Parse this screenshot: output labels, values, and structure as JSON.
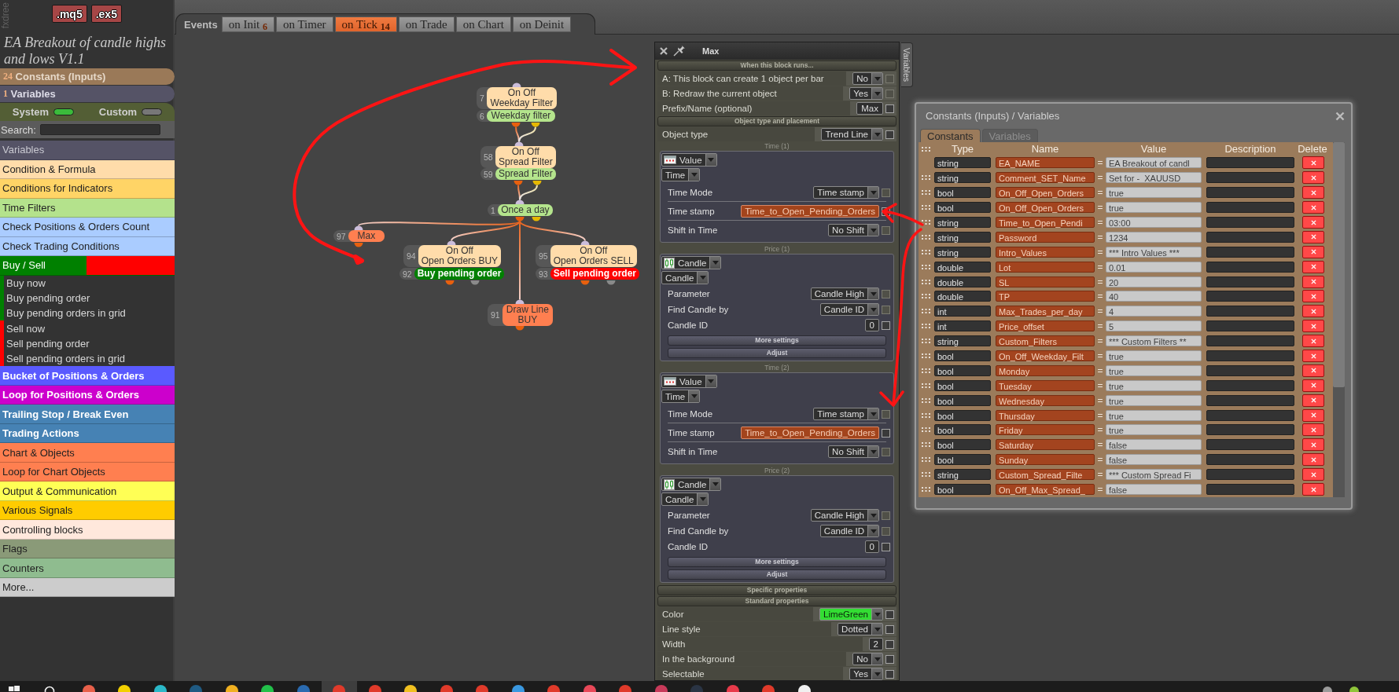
{
  "app": {
    "logo_text": "fxdree",
    "export_buttons": [
      ".mq5",
      ".ex5"
    ],
    "project_title": "EA Breakout of candle highs and lows V1.1"
  },
  "sidebar": {
    "constants": {
      "count": "24",
      "label": "Constants (Inputs)"
    },
    "variables": {
      "count": "1",
      "label": "Variables"
    },
    "toggles": [
      {
        "label": "System",
        "on": true
      },
      {
        "label": "Custom",
        "on": false
      }
    ],
    "search": {
      "label": "Search:"
    },
    "categories": [
      {
        "kind": "category",
        "label": "Variables",
        "color": "#555366"
      },
      {
        "kind": "category",
        "label": "Condition & Formula",
        "color": "#ffdcaa"
      },
      {
        "kind": "category",
        "label": "Conditions for Indicators",
        "color": "#ffd466"
      },
      {
        "kind": "category",
        "label": "Time Filters",
        "color": "#b4e28c"
      },
      {
        "kind": "category",
        "label": "Check Positions & Orders Count",
        "color": "#aaccff"
      },
      {
        "kind": "category",
        "label": "Check Trading Conditions",
        "color": "#aaccff"
      },
      {
        "kind": "split",
        "label": "Buy / Sell",
        "color": "#008000",
        "accent": {
          "color": "#ff0000"
        },
        "children": [
          {
            "label": "Buy now",
            "color": "#008000"
          },
          {
            "label": "Buy pending order",
            "color": "#008000"
          },
          {
            "label": "Buy pending orders in grid",
            "color": "#008000"
          },
          {
            "label": "Sell now",
            "color": "#ff0000"
          },
          {
            "label": "Sell pending order",
            "color": "#ff0000"
          },
          {
            "label": "Sell pending orders in grid",
            "color": "#ff0000"
          }
        ]
      },
      {
        "kind": "category",
        "label": "Bucket of Positions & Orders",
        "color": "#5a5aff"
      },
      {
        "kind": "category",
        "label": "Loop for Positions & Orders",
        "color": "#cc00cc"
      },
      {
        "kind": "category",
        "label": "Trailing Stop / Break Even",
        "color": "#4682b4"
      },
      {
        "kind": "category",
        "label": "Trading Actions",
        "color": "#4682b4"
      },
      {
        "kind": "category",
        "label": "Chart & Objects",
        "color": "#ff7f50"
      },
      {
        "kind": "category",
        "label": "Loop for Chart Objects",
        "color": "#ff7f50"
      },
      {
        "kind": "category",
        "label": "Output & Communication",
        "color": "#ffff55"
      },
      {
        "kind": "category",
        "label": "Various Signals",
        "color": "#ffcc00"
      },
      {
        "kind": "category",
        "label": "Controlling blocks",
        "color": "#ffe8dc"
      },
      {
        "kind": "category",
        "label": "Flags",
        "color": "#8a9a78"
      },
      {
        "kind": "category",
        "label": "Counters",
        "color": "#8fbc8f"
      },
      {
        "kind": "category",
        "label": "More...",
        "color": "#cccccc"
      }
    ]
  },
  "events": {
    "label": "Events",
    "tabs": [
      {
        "label": "on Init",
        "count": "6",
        "selected": false
      },
      {
        "label": "on Timer",
        "selected": false
      },
      {
        "label": "on Tick",
        "count": "14",
        "selected": true
      },
      {
        "label": "on Trade",
        "selected": false
      },
      {
        "label": "on Chart",
        "selected": false
      },
      {
        "label": "on Deinit",
        "selected": false
      }
    ]
  },
  "canvas": {
    "blocks": [
      {
        "number": "7",
        "lines": [
          "On Off",
          "Weekday Filter"
        ],
        "color": "#ffdcaa"
      },
      {
        "number": "6",
        "lines": [
          "Weekday filter"
        ],
        "color": "#b4e48c"
      },
      {
        "number": "58",
        "lines": [
          "On Off",
          "Spread Filter"
        ],
        "color": "#ffdcaa"
      },
      {
        "number": "59",
        "lines": [
          "Spread Filter"
        ],
        "color": "#b4e48c"
      },
      {
        "number": "1",
        "lines": [
          "Once a day"
        ],
        "color": "#b4e48c"
      },
      {
        "number": "97",
        "lines": [
          "Max"
        ],
        "color": "#ff7f50"
      },
      {
        "number": "94",
        "lines": [
          "On Off",
          "Open Orders BUY"
        ],
        "color": "#ffdcaa"
      },
      {
        "number": "92",
        "lines": [
          "Buy pending order"
        ],
        "color": "#008000"
      },
      {
        "number": "95",
        "lines": [
          "On Off",
          "Open Orders SELL"
        ],
        "color": "#ffdcaa"
      },
      {
        "number": "93",
        "lines": [
          "Sell pending order"
        ],
        "color": "#ff0000"
      },
      {
        "number": "91",
        "lines": [
          "Draw Line",
          "BUY"
        ],
        "color": "#ff7f50"
      }
    ]
  },
  "block_panel": {
    "title": "Max",
    "side_tab": "Variables",
    "items": [
      {
        "kind": "section",
        "title": "When this block runs..."
      },
      {
        "kind": "row",
        "label": "A: This block can create 1 object per bar",
        "control": {
          "kind": "dropdown",
          "value": "No"
        },
        "checkbox": {
          "checked": false,
          "disabled": true
        }
      },
      {
        "kind": "row",
        "label": "B: Redraw the current object",
        "control": {
          "kind": "dropdown",
          "value": "Yes"
        },
        "checkbox": {
          "checked": false,
          "disabled": true
        }
      },
      {
        "kind": "row",
        "label": "Prefix/Name (optional)",
        "control": {
          "kind": "input",
          "value": "Max"
        },
        "checkbox": {
          "checked": false,
          "disabled": false
        }
      },
      {
        "kind": "section",
        "title": "Object type and placement"
      },
      {
        "kind": "row",
        "label": "Object type",
        "control": {
          "kind": "dropdown",
          "value": "Trend Line"
        },
        "checkbox": {
          "checked": false,
          "disabled": false
        }
      },
      {
        "kind": "time_group",
        "caption": "Time (1)",
        "selectors": [
          "Value",
          "Time"
        ],
        "rows": [
          {
            "label": "Time Mode",
            "control": {
              "kind": "dropdown",
              "value": "Time stamp"
            },
            "checkbox": {
              "checked": false,
              "disabled": true
            }
          },
          {
            "label": "Time stamp",
            "control": {
              "kind": "constant",
              "value": "Time_to_Open_Pending_Orders"
            },
            "checkbox": {
              "checked": false,
              "disabled": false
            }
          },
          {
            "label": "Shift in Time",
            "control": {
              "kind": "dropdown",
              "value": "No Shift"
            },
            "checkbox": {
              "checked": false,
              "disabled": true
            }
          }
        ]
      },
      {
        "kind": "price_group",
        "caption": "Price (1)",
        "selectors": [
          "Candle",
          "Candle"
        ],
        "rows": [
          {
            "label": "Parameter",
            "control": {
              "kind": "dropdown",
              "value": "Candle High"
            },
            "checkbox": {
              "checked": false,
              "disabled": true
            }
          },
          {
            "label": "Find Candle by",
            "control": {
              "kind": "dropdown",
              "value": "Candle ID"
            },
            "checkbox": {
              "checked": false,
              "disabled": true
            }
          },
          {
            "label": "Candle ID",
            "control": {
              "kind": "input",
              "value": "0"
            },
            "checkbox": {
              "checked": false,
              "disabled": false
            }
          }
        ],
        "buttons": [
          "More settings",
          "Adjust"
        ]
      },
      {
        "kind": "time_group",
        "caption": "Time (2)",
        "selectors": [
          "Value",
          "Time"
        ],
        "rows": [
          {
            "label": "Time Mode",
            "control": {
              "kind": "dropdown",
              "value": "Time stamp"
            },
            "checkbox": {
              "checked": false,
              "disabled": true
            }
          },
          {
            "label": "Time stamp",
            "control": {
              "kind": "constant",
              "value": "Time_to_Open_Pending_Orders"
            },
            "checkbox": {
              "checked": false,
              "disabled": false
            }
          },
          {
            "label": "Shift in Time",
            "control": {
              "kind": "dropdown",
              "value": "No Shift"
            },
            "checkbox": {
              "checked": false,
              "disabled": true
            }
          }
        ]
      },
      {
        "kind": "price_group",
        "caption": "Price (2)",
        "selectors": [
          "Candle",
          "Candle"
        ],
        "rows": [
          {
            "label": "Parameter",
            "control": {
              "kind": "dropdown",
              "value": "Candle High"
            },
            "checkbox": {
              "checked": false,
              "disabled": true
            }
          },
          {
            "label": "Find Candle by",
            "control": {
              "kind": "dropdown",
              "value": "Candle ID"
            },
            "checkbox": {
              "checked": false,
              "disabled": true
            }
          },
          {
            "label": "Candle ID",
            "control": {
              "kind": "input",
              "value": "0"
            },
            "checkbox": {
              "checked": false,
              "disabled": false
            }
          }
        ],
        "buttons": [
          "More settings",
          "Adjust"
        ]
      },
      {
        "kind": "section",
        "title": "Specific properties"
      },
      {
        "kind": "section",
        "title": "Standard properties"
      },
      {
        "kind": "row",
        "label": "Color",
        "control": {
          "kind": "dropdown",
          "value": "LimeGreen",
          "color": "#33dd33"
        },
        "checkbox": {
          "checked": false,
          "disabled": false
        }
      },
      {
        "kind": "row",
        "label": "Line style",
        "control": {
          "kind": "dropdown",
          "value": "Dotted"
        },
        "checkbox": {
          "checked": false,
          "disabled": false
        }
      },
      {
        "kind": "row",
        "label": "Width",
        "control": {
          "kind": "input",
          "value": "2"
        },
        "checkbox": {
          "checked": false,
          "disabled": false
        }
      },
      {
        "kind": "row",
        "label": "In the background",
        "control": {
          "kind": "dropdown",
          "value": "No"
        },
        "checkbox": {
          "checked": false,
          "disabled": false
        }
      },
      {
        "kind": "row",
        "label": "Selectable",
        "control": {
          "kind": "dropdown",
          "value": "Yes"
        },
        "checkbox": {
          "checked": false,
          "disabled": false
        }
      }
    ]
  },
  "constants_window": {
    "title": "Constants (Inputs) / Variables",
    "tabs": [
      {
        "label": "Constants",
        "selected": true
      },
      {
        "label": "Variables",
        "selected": false
      }
    ],
    "columns": [
      "Type",
      "Name",
      "Value",
      "Description",
      "Delete"
    ],
    "rows": [
      {
        "type": "string",
        "name": "EA_NAME",
        "operator": "=",
        "value": "EA Breakout of candl"
      },
      {
        "type": "string",
        "name": "Comment_SET_Name",
        "operator": "=",
        "value": "Set for -  XAUUSD"
      },
      {
        "type": "bool",
        "name": "On_Off_Open_Orders",
        "operator": "=",
        "value": "true"
      },
      {
        "type": "bool",
        "name": "On_Off_Open_Orders",
        "operator": "=",
        "value": "true"
      },
      {
        "type": "string",
        "name": "Time_to_Open_Pendi",
        "operator": "=",
        "value": "03:00"
      },
      {
        "type": "string",
        "name": "Password",
        "operator": "=",
        "value": "1234"
      },
      {
        "type": "string",
        "name": "Intro_Values",
        "operator": "=",
        "value": "*** Intro Values ***"
      },
      {
        "type": "double",
        "name": "Lot",
        "operator": "=",
        "value": "0.01"
      },
      {
        "type": "double",
        "name": "SL",
        "operator": "=",
        "value": "20"
      },
      {
        "type": "double",
        "name": "TP",
        "operator": "=",
        "value": "40"
      },
      {
        "type": "int",
        "name": "Max_Trades_per_day",
        "operator": "=",
        "value": "4"
      },
      {
        "type": "int",
        "name": "Price_offset",
        "operator": "=",
        "value": "5"
      },
      {
        "type": "string",
        "name": "Custom_Filters",
        "operator": "=",
        "value": "*** Custom Filters **"
      },
      {
        "type": "bool",
        "name": "On_Off_Weekday_Filt",
        "operator": "=",
        "value": "true"
      },
      {
        "type": "bool",
        "name": "Monday",
        "operator": "=",
        "value": "true"
      },
      {
        "type": "bool",
        "name": "Tuesday",
        "operator": "=",
        "value": "true"
      },
      {
        "type": "bool",
        "name": "Wednesday",
        "operator": "=",
        "value": "true"
      },
      {
        "type": "bool",
        "name": "Thursday",
        "operator": "=",
        "value": "true"
      },
      {
        "type": "bool",
        "name": "Friday",
        "operator": "=",
        "value": "true"
      },
      {
        "type": "bool",
        "name": "Saturday",
        "operator": "=",
        "value": "false"
      },
      {
        "type": "bool",
        "name": "Sunday",
        "operator": "=",
        "value": "false"
      },
      {
        "type": "string",
        "name": "Custom_Spread_Filte",
        "operator": "=",
        "value": "*** Custom Spread Fi"
      },
      {
        "type": "bool",
        "name": "On_Off_Max_Spread_",
        "operator": "=",
        "value": "false"
      }
    ]
  },
  "taskbar": {
    "apps": [
      {
        "color": "#e8604a",
        "selected": false
      },
      {
        "color": "#f2d000",
        "selected": false
      },
      {
        "color": "#2bb8c8",
        "selected": false
      },
      {
        "color": "#1f5a82",
        "selected": false
      },
      {
        "color": "#f0b020",
        "selected": false
      },
      {
        "color": "#22c04a",
        "selected": false
      },
      {
        "color": "#2a6ab0",
        "selected": false
      },
      {
        "color": "#e03a2a",
        "selected": true
      },
      {
        "color": "#e03a2a",
        "selected": false
      },
      {
        "color": "#f0c020",
        "selected": false
      },
      {
        "color": "#e03a2a",
        "selected": false
      },
      {
        "color": "#e03a2a",
        "selected": false
      },
      {
        "color": "#3a98e0",
        "selected": false
      },
      {
        "color": "#e03a2a",
        "selected": false
      },
      {
        "color": "#e84858",
        "selected": false
      },
      {
        "color": "#e03a2a",
        "selected": false
      },
      {
        "color": "#c83a5a",
        "selected": false
      },
      {
        "color": "#2a3444",
        "selected": false
      },
      {
        "color": "#e83a4a",
        "selected": false
      },
      {
        "color": "#e03a2a",
        "selected": false
      },
      {
        "color": "#f0f0f0",
        "selected": false
      }
    ],
    "tray": [
      {
        "color": "#9a9a9a"
      },
      {
        "color": "#8fc43a"
      }
    ]
  }
}
